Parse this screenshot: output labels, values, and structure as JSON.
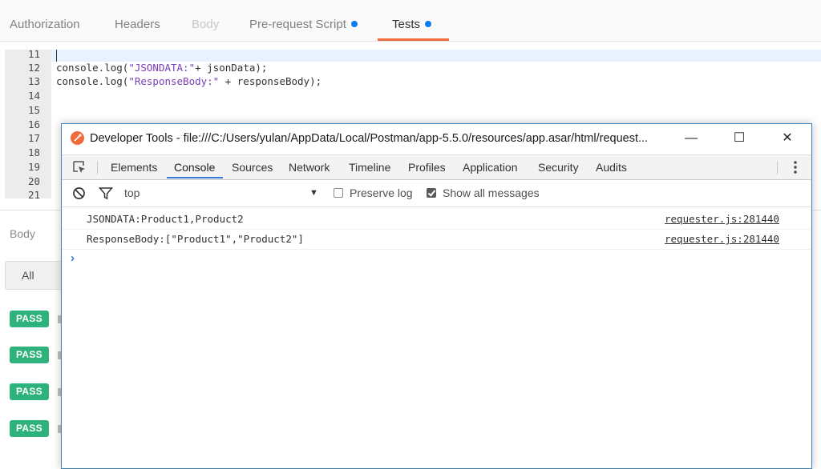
{
  "postman": {
    "tabs": [
      {
        "label": "Authorization"
      },
      {
        "label": "Headers"
      },
      {
        "label": "Body"
      },
      {
        "label": "Pre-request Script"
      },
      {
        "label": "Tests"
      }
    ],
    "active_tab": "Tests",
    "accent_color": "#f26b3a",
    "dot_color": "#097bed",
    "editor": {
      "line_numbers": [
        "11",
        "12",
        "13",
        "14",
        "15",
        "16",
        "17",
        "18",
        "19",
        "20",
        "21"
      ],
      "code": {
        "line12": {
          "pre": "console.log(",
          "str": "\"JSONDATA:\"",
          "post": "+ jsonData);"
        },
        "line13": {
          "pre": "console.log(",
          "str": "\"ResponseBody:\"",
          "post": " + responseBody);"
        }
      }
    },
    "response": {
      "body_label": "Body",
      "all_button": "All",
      "test_results": [
        {
          "status": "PASS"
        },
        {
          "status": "PASS"
        },
        {
          "status": "PASS"
        },
        {
          "status": "PASS"
        }
      ],
      "pass_color": "#2eb27c"
    }
  },
  "devtools": {
    "title": "Developer Tools - file:///C:/Users/yulan/AppData/Local/Postman/app-5.5.0/resources/app.asar/html/request...",
    "window_buttons": {
      "minimize": "—",
      "maximize": "☐",
      "close": "✕"
    },
    "tabs": [
      {
        "label": "Elements"
      },
      {
        "label": "Console"
      },
      {
        "label": "Sources"
      },
      {
        "label": "Network"
      },
      {
        "label": "Timeline"
      },
      {
        "label": "Profiles"
      },
      {
        "label": "Application"
      },
      {
        "label": "Security"
      },
      {
        "label": "Audits"
      }
    ],
    "active_tab": "Console",
    "console_toolbar": {
      "context": "top",
      "preserve_log": {
        "label": "Preserve log",
        "checked": false
      },
      "show_all_messages": {
        "label": "Show all messages",
        "checked": true
      }
    },
    "console_messages": [
      {
        "text": "JSONDATA:Product1,Product2",
        "source": "requester.js:281440"
      },
      {
        "text": "ResponseBody:[\"Product1\",\"Product2\"]",
        "source": "requester.js:281440"
      }
    ],
    "prompt_symbol": "›",
    "accent_color": "#3879d9"
  }
}
